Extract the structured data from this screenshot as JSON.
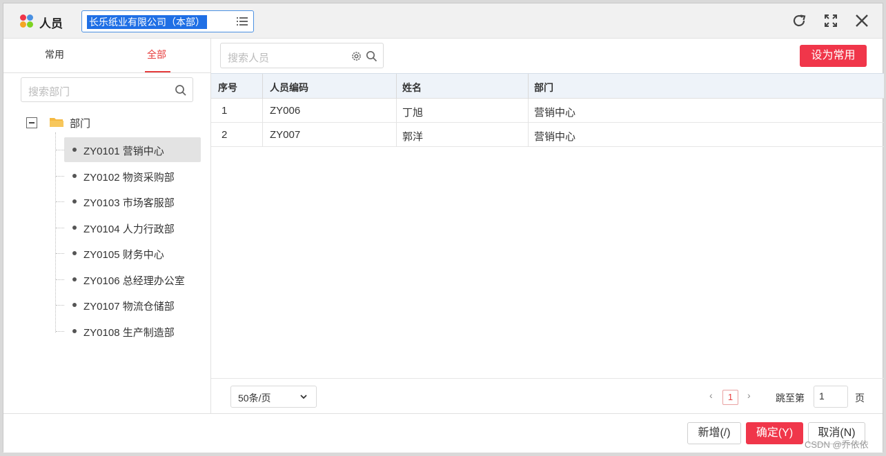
{
  "titlebar": {
    "title": "人员",
    "org_selected": "长乐纸业有限公司（本部）",
    "icons": [
      "refresh-icon",
      "fullscreen-icon",
      "close-icon"
    ]
  },
  "left": {
    "tabs": [
      {
        "label": "常用"
      },
      {
        "label": "全部"
      }
    ],
    "active_tab": "全部",
    "search_placeholder": "搜索部门",
    "tree_root": "部门",
    "departments": [
      {
        "label": "ZY0101 营销中心"
      },
      {
        "label": "ZY0102 物资采购部"
      },
      {
        "label": "ZY0103 市场客服部"
      },
      {
        "label": "ZY0104 人力行政部"
      },
      {
        "label": "ZY0105 财务中心"
      },
      {
        "label": "ZY0106 总经理办公室"
      },
      {
        "label": "ZY0107 物流仓储部"
      },
      {
        "label": "ZY0108 生产制造部"
      }
    ],
    "selected_department": "ZY0101 营销中心"
  },
  "right": {
    "search_placeholder": "搜索人员",
    "set_common_label": "设为常用",
    "columns": [
      "序号",
      "人员编码",
      "姓名",
      "部门"
    ],
    "rows": [
      [
        "1",
        "ZY006",
        "丁旭",
        "营销中心"
      ],
      [
        "2",
        "ZY007",
        "郭洋",
        "营销中心"
      ]
    ],
    "pager": {
      "page_size": "50条/页",
      "prev": "‹",
      "current_page": "1",
      "next": "›",
      "jump_label": "跳至第",
      "jump_value": "1",
      "page_unit": "页"
    }
  },
  "footer": {
    "add_label": "新增(/)",
    "confirm_label": "确定(Y)",
    "cancel_label": "取消(N)"
  },
  "watermark": "CSDN @乔依依",
  "colors": {
    "accent": "#f0364a",
    "tab_active": "#e63c3c",
    "header_bg": "#eef3f9"
  }
}
